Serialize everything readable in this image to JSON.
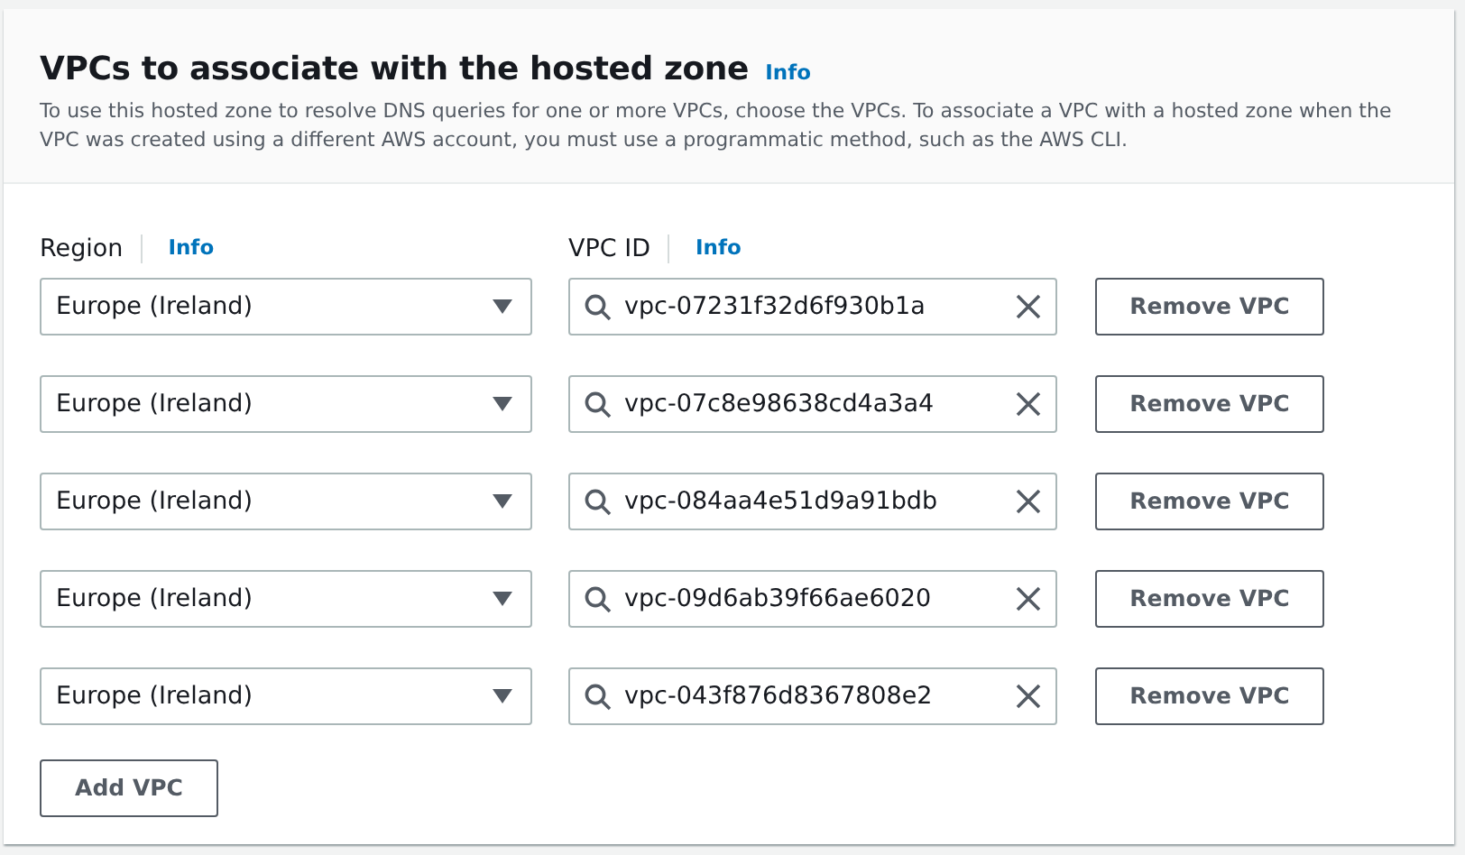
{
  "header": {
    "title": "VPCs to associate with the hosted zone",
    "info": "Info",
    "description": "To use this hosted zone to resolve DNS queries for one or more VPCs, choose the VPCs. To associate a VPC with a hosted zone when the VPC was created using a different AWS account, you must use a programmatic method, such as the AWS CLI."
  },
  "labels": {
    "region": "Region",
    "region_info": "Info",
    "vpc_id": "VPC ID",
    "vpc_info": "Info"
  },
  "rows": [
    {
      "region": "Europe (Ireland)",
      "vpc_id": "vpc-07231f32d6f930b1a",
      "remove": "Remove VPC"
    },
    {
      "region": "Europe (Ireland)",
      "vpc_id": "vpc-07c8e98638cd4a3a4",
      "remove": "Remove VPC"
    },
    {
      "region": "Europe (Ireland)",
      "vpc_id": "vpc-084aa4e51d9a91bdb",
      "remove": "Remove VPC"
    },
    {
      "region": "Europe (Ireland)",
      "vpc_id": "vpc-09d6ab39f66ae6020",
      "remove": "Remove VPC"
    },
    {
      "region": "Europe (Ireland)",
      "vpc_id": "vpc-043f876d8367808e2",
      "remove": "Remove VPC"
    }
  ],
  "add_button": "Add VPC"
}
